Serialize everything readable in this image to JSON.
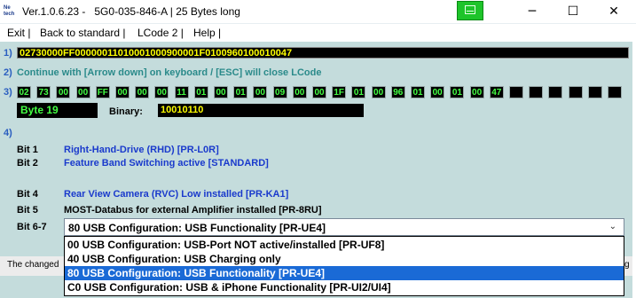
{
  "window": {
    "title": "Ver.1.0.6.23 -   5G0-035-846-A | 25 Bytes long",
    "app_icon": "netech-app-icon",
    "app_icon_text": "Ne\ntech",
    "icon_button": "edit-icon",
    "minimize": "─",
    "maximize": "☐",
    "close": "✕"
  },
  "menu": {
    "items": [
      "Exit |",
      "Back to standard |",
      "LCode 2 |",
      "Help |"
    ]
  },
  "section1": {
    "num": "1)",
    "hex": "02730000FF00000011010001000900001F0100960100010047"
  },
  "section2": {
    "num": "2)",
    "instruction": "Continue with [Arrow down] on keyboard / [ESC] will close LCode"
  },
  "section3": {
    "num": "3)",
    "bytes": [
      "02",
      "73",
      "00",
      "00",
      "FF",
      "00",
      "00",
      "00",
      "11",
      "01",
      "00",
      "01",
      "00",
      "09",
      "00",
      "00",
      "1F",
      "01",
      "00",
      "96",
      "01",
      "00",
      "01",
      "00",
      "47",
      "",
      "",
      "",
      "",
      "",
      ""
    ]
  },
  "byte_info": {
    "byte_label": "Byte 19",
    "binary_label": "Binary:",
    "binary_value": "10010110"
  },
  "section4": {
    "num": "4)",
    "bits": [
      {
        "label": "Bit 1",
        "desc": "Right-Hand-Drive (RHD) [PR-L0R]",
        "color": "#1a3acc"
      },
      {
        "label": "Bit 2",
        "desc": "Feature Band Switching active [STANDARD]",
        "color": "#1a3acc"
      },
      {
        "label": "Bit 4",
        "desc": "Rear View Camera (RVC) Low installed [PR-KA1]",
        "color": "#1a3acc"
      },
      {
        "label": "Bit 5",
        "desc": "MOST-Databus for external Amplifier installed [PR-8RU]",
        "color": "#000000"
      }
    ],
    "bit67_label": "Bit 6-7",
    "select_value": "80 USB Configuration: USB Functionality [PR-UE4]",
    "chevron": "chevron-down-icon",
    "options": [
      "00 USB Configuration: USB-Port NOT active/installed [PR-UF8]",
      "40 USB Configuration: USB Charging only",
      "80 USB Configuration: USB Functionality [PR-UE4]",
      "C0 USB Configuration: USB & iPhone Functionality [PR-UI2/UI4]"
    ],
    "selected_index": 2
  },
  "status": {
    "text": "The changed",
    "right_text": "g"
  },
  "colors": {
    "client_bg": "#c4dcdc",
    "hex_text": "#ffff00",
    "byte_text": "#44ff44",
    "accent": "#1a6ad6"
  }
}
